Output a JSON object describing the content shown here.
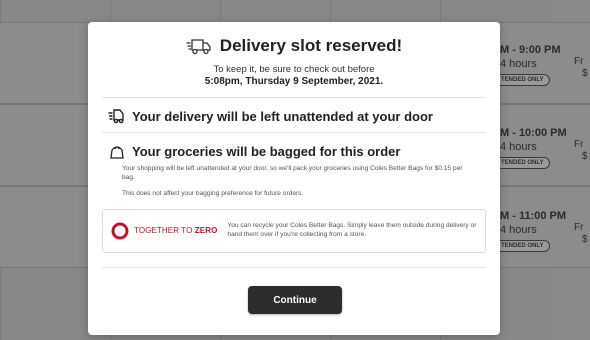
{
  "background": {
    "slots": [
      {
        "time": "M - 9:00 PM",
        "hours": "4 hours",
        "pill": "TENDED ONLY",
        "fr": "Fr",
        "fr_sub": "$"
      },
      {
        "time": "M - 10:00 PM",
        "hours": "4 hours",
        "pill": "TENDED ONLY",
        "fr": "Fr",
        "fr_sub": "$"
      },
      {
        "time": "M - 11:00 PM",
        "hours": "4 hours",
        "pill": "TENDED ONLY",
        "fr": "Fr",
        "fr_sub": "$"
      }
    ]
  },
  "modal": {
    "title": "Delivery slot reserved!",
    "subtitle": "To keep it, be sure to check out before",
    "deadline": "5:08pm, Thursday 9 September, 2021.",
    "unattended_heading": "Your delivery will be left unattended at your door",
    "bagged_heading": "Your groceries will be bagged for this order",
    "bagged_para1": "Your shopping will be left unattended at your door, so we'll pack your groceries using Coles Better Bags for $0.15 per bag.",
    "bagged_para2": "This does not affect your bagging preference for future orders.",
    "info": {
      "logo_text_a": "TOGETHER TO",
      "logo_text_b": "ZERO",
      "text": "You can recycle your Coles Better Bags. Simply leave them outside during delivery or hand them over if you're collecting from a store."
    },
    "continue_label": "Continue"
  },
  "colors": {
    "overlay": "#8a8a8a",
    "button": "#2d2d2d",
    "brand_red": "#c8102e"
  },
  "icons": [
    "truck-icon",
    "unattended-delivery-icon",
    "bag-icon",
    "together-to-zero-logo"
  ]
}
